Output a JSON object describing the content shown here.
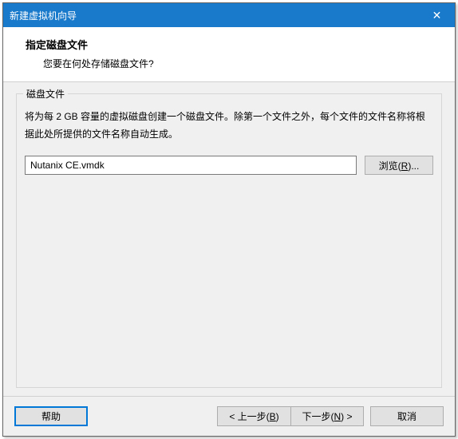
{
  "titlebar": {
    "title": "新建虚拟机向导",
    "close": "✕"
  },
  "header": {
    "title": "指定磁盘文件",
    "subtitle": "您要在何处存储磁盘文件?"
  },
  "group": {
    "label": "磁盘文件",
    "description": "将为每 2 GB 容量的虚拟磁盘创建一个磁盘文件。除第一个文件之外，每个文件的文件名称将根据此处所提供的文件名称自动生成。",
    "filename": "Nutanix CE.vmdk",
    "browse_label": "浏览(",
    "browse_key": "R",
    "browse_suffix": ")..."
  },
  "footer": {
    "help": "帮助",
    "back_prefix": "< 上一步(",
    "back_key": "B",
    "back_suffix": ")",
    "next_prefix": "下一步(",
    "next_key": "N",
    "next_suffix": ") >",
    "cancel": "取消"
  }
}
